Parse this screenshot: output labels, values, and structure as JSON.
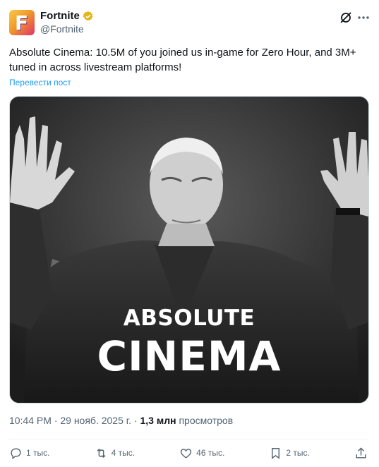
{
  "author": {
    "name": "Fortnite",
    "handle": "@Fortnite",
    "avatar_letter": "F",
    "verified_color": "#e2b719"
  },
  "tweet": {
    "text": "Absolute Cinema: 10.5M of you joined us in-game for Zero Hour, and 3M+ tuned in across livestream platforms!",
    "translate_label": "Перевести пост"
  },
  "media": {
    "caption_line1": "ABSOLUTE",
    "caption_line2": "CINEMA"
  },
  "meta": {
    "timestamp": "10:44 PM · 29 нояб. 2025 г.",
    "separator": " · ",
    "views_count": "1,3 млн",
    "views_label": " просмотров"
  },
  "actions": {
    "replies": "1 тыс.",
    "reposts": "4 тыс.",
    "likes": "46 тыс.",
    "bookmarks": "2 тыс."
  },
  "icons": [
    "grok-icon",
    "more-icon",
    "reply-icon",
    "repost-icon",
    "like-icon",
    "bookmark-icon",
    "share-icon"
  ],
  "colors": {
    "accent": "#1d9bf0",
    "text": "#0f1419",
    "secondary": "#536471"
  }
}
